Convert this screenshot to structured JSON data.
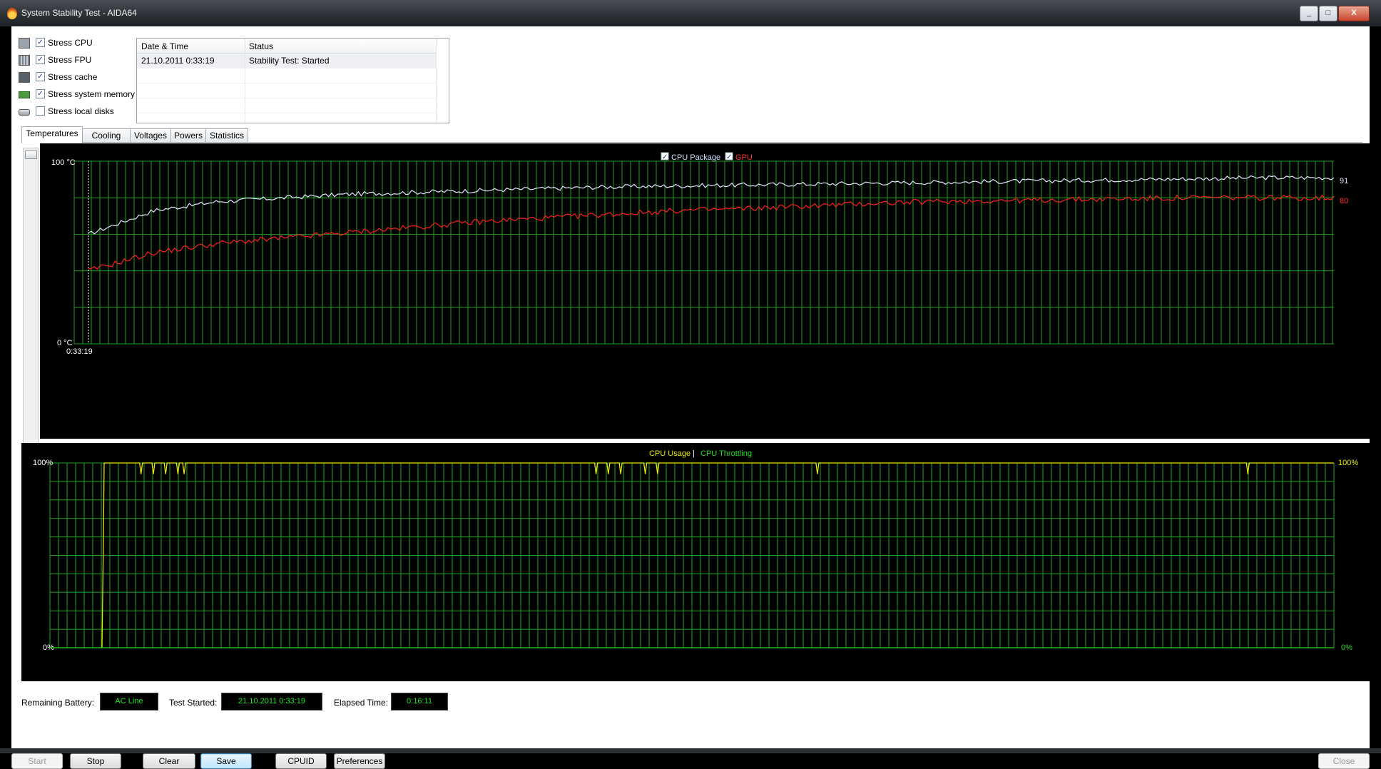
{
  "window": {
    "title": "System Stability Test - AIDA64",
    "controls": [
      "_",
      "□",
      "X"
    ]
  },
  "stress_options": [
    {
      "label": "Stress CPU",
      "checked": true,
      "icon": "cpu-chip-icon"
    },
    {
      "label": "Stress FPU",
      "checked": true,
      "icon": "fpu-chip-icon"
    },
    {
      "label": "Stress cache",
      "checked": true,
      "icon": "cache-chip-icon"
    },
    {
      "label": "Stress system memory",
      "checked": true,
      "icon": "memory-module-icon"
    },
    {
      "label": "Stress local disks",
      "checked": false,
      "icon": "hard-disk-icon"
    }
  ],
  "status_table": {
    "columns": [
      "Date & Time",
      "Status"
    ],
    "rows": [
      {
        "datetime": "21.10.2011 0:33:19",
        "status": "Stability Test: Started"
      }
    ]
  },
  "tabs": [
    {
      "label": "Temperatures",
      "active": true
    },
    {
      "label": "Cooling Fans",
      "active": false
    },
    {
      "label": "Voltages",
      "active": false
    },
    {
      "label": "Powers",
      "active": false
    },
    {
      "label": "Statistics",
      "active": false
    }
  ],
  "chart_data": [
    {
      "type": "line",
      "legend": [
        {
          "name": "CPU Package",
          "checked": true,
          "color": "#d8e4ff"
        },
        {
          "name": "GPU",
          "checked": true,
          "color": "#ff2020"
        }
      ],
      "y_top_label": "100 °C",
      "y_bottom_label": "0 °C",
      "x_start_label": "0:33:19",
      "ylim": [
        0,
        100
      ],
      "grid": true,
      "grid_color": "#1fa01f",
      "series": [
        {
          "name": "CPU Package",
          "end_value_label": "91",
          "values": [
            60,
            73,
            78,
            80,
            82,
            83,
            84,
            85,
            86,
            86.5,
            87,
            87.5,
            88,
            88.5,
            89,
            89.5,
            90,
            90.5,
            91,
            91
          ]
        },
        {
          "name": "GPU",
          "end_value_label": "80",
          "values": [
            40,
            50,
            55,
            58,
            61,
            64,
            67,
            69,
            71,
            73,
            74,
            75.5,
            77,
            78,
            78.5,
            79,
            79.5,
            80,
            80,
            80
          ]
        }
      ]
    },
    {
      "type": "line",
      "legend": [
        {
          "name": "CPU Usage",
          "color": "#e8e800"
        },
        {
          "name": "CPU Throttling",
          "color": "#22dd22"
        }
      ],
      "legend_separator": "|",
      "y_left_top_label": "100%",
      "y_left_bottom_label": "0%",
      "y_right_top_label": "100%",
      "y_right_bottom_label": "0%",
      "ylim": [
        0,
        100
      ],
      "grid": true,
      "grid_color": "#1fa01f",
      "series": [
        {
          "name": "CPU Usage",
          "start_value": 0,
          "steady_value": 100,
          "dips_at_fraction": [
            0.03,
            0.04,
            0.05,
            0.06,
            0.065,
            0.4,
            0.41,
            0.42,
            0.44,
            0.45,
            0.58,
            0.93
          ]
        },
        {
          "name": "CPU Throttling",
          "steady_value": 0
        }
      ]
    }
  ],
  "info_bar": {
    "remaining_battery_label": "Remaining Battery:",
    "remaining_battery_value": "AC Line",
    "test_started_label": "Test Started:",
    "test_started_value": "21.10.2011 0:33:19",
    "elapsed_time_label": "Elapsed Time:",
    "elapsed_time_value": "0:16:11"
  },
  "buttons": {
    "start": "Start",
    "stop": "Stop",
    "clear": "Clear",
    "save": "Save",
    "cpuid": "CPUID",
    "preferences": "Preferences",
    "close": "Close"
  }
}
